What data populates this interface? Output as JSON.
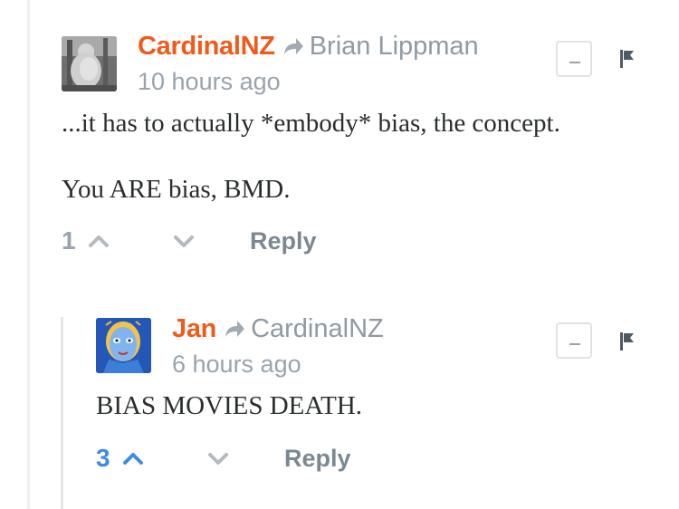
{
  "comments": [
    {
      "author": "CardinalNZ",
      "reply_to": "Brian Lippman",
      "time": "10 hours ago",
      "paragraphs": [
        "...it has to actually *embody* bias, the concept.",
        "You ARE bias, BMD."
      ],
      "votes": "1",
      "reply_label": "Reply",
      "collapse_label": "—"
    },
    {
      "author": "Jan",
      "reply_to": "CardinalNZ",
      "time": "6 hours ago",
      "paragraphs": [
        "BIAS MOVIES DEATH."
      ],
      "votes": "3",
      "votes_active": true,
      "reply_label": "Reply",
      "collapse_label": "—"
    }
  ],
  "colors": {
    "author": "#f05a1a",
    "muted": "#9aa3ad",
    "vote_active": "#3d8ce0",
    "body_text": "#2a2e2e"
  },
  "icons": {
    "reply_indicator": "reply-arrow-icon",
    "upvote": "chevron-up-icon",
    "downvote": "chevron-down-icon",
    "flag": "flag-icon",
    "collapse": "minus-icon"
  }
}
